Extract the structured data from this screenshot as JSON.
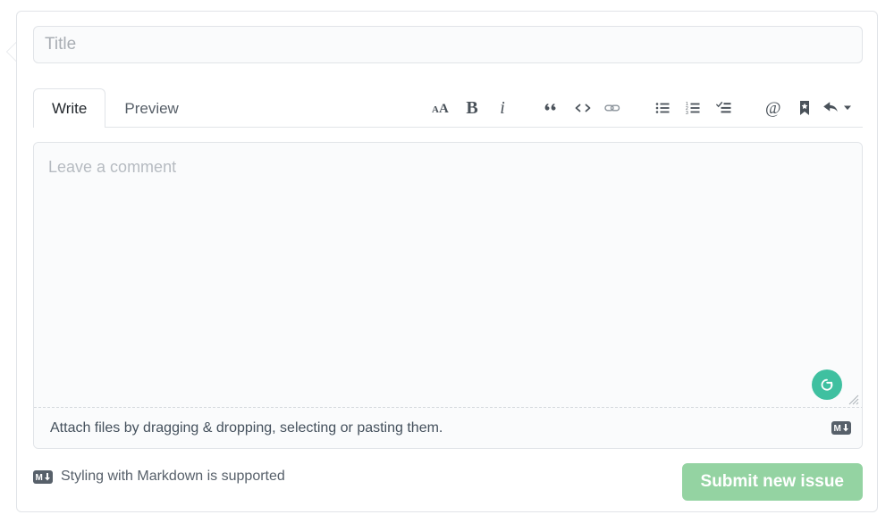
{
  "form": {
    "title_input": {
      "value": "",
      "placeholder": "Title"
    },
    "tabs": [
      {
        "label": "Write",
        "name": "tab-write",
        "selected": true
      },
      {
        "label": "Preview",
        "name": "tab-preview",
        "selected": false
      }
    ],
    "toolbar": {
      "groups": [
        {
          "buttons": [
            {
              "name": "heading-icon",
              "label": "AA",
              "title": "Add header text"
            },
            {
              "name": "bold-icon",
              "label": "B",
              "title": "Add bold text"
            },
            {
              "name": "italic-icon",
              "label": "i",
              "title": "Add italic text"
            }
          ]
        },
        {
          "buttons": [
            {
              "name": "quote-icon",
              "label": "“",
              "title": "Insert a quote"
            },
            {
              "name": "code-icon",
              "label": "<>",
              "title": "Insert code"
            },
            {
              "name": "link-icon",
              "label": "",
              "title": "Add a link"
            }
          ]
        },
        {
          "buttons": [
            {
              "name": "unordered-list-icon",
              "label": "",
              "title": "Add a bulleted list"
            },
            {
              "name": "ordered-list-icon",
              "label": "",
              "title": "Add a numbered list"
            },
            {
              "name": "task-list-icon",
              "label": "",
              "title": "Add a task list"
            }
          ]
        },
        {
          "buttons": [
            {
              "name": "mention-icon",
              "label": "@",
              "title": "Directly mention a user or team"
            },
            {
              "name": "saved-replies-icon",
              "label": "",
              "title": "Reference an issue, pull request, or discussion"
            },
            {
              "name": "reply-icon",
              "label": "",
              "title": "Add saved reply"
            }
          ]
        }
      ]
    },
    "comment_input": {
      "value": "",
      "placeholder": "Leave a comment"
    },
    "attach_bar": {
      "text": "Attach files by dragging & dropping, selecting or pasting them.",
      "badge_icon": "markdown-icon"
    },
    "grammarly": {
      "icon": "grammarly-icon",
      "letter": "G"
    },
    "resize_handle": {
      "icon": "resize-grip-icon"
    },
    "footer": {
      "markdown_note": "Styling with Markdown is supported",
      "markdown_icon": "markdown-icon",
      "submit_label": "Submit new issue"
    }
  },
  "colors": {
    "border": "#e1e4e8",
    "field_background": "#fafbfc",
    "submit_green": "#94d3a2",
    "grammarly_green": "#3fc0a0",
    "icon_gray": "#586069",
    "badge_dark": "#57606a",
    "placeholder": "#b6bbc1",
    "text": "#24292e"
  }
}
